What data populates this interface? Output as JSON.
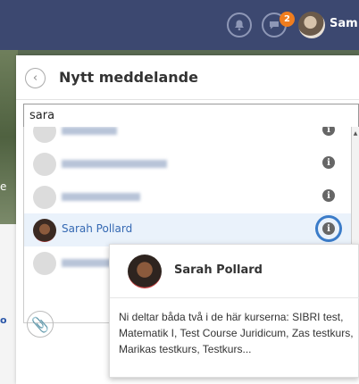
{
  "topbar": {
    "icons": [
      "bell-icon",
      "chat-icon"
    ],
    "badge_count": "2",
    "user_name": "Sam"
  },
  "background": {
    "letter": "e",
    "link_char": "o"
  },
  "dialog": {
    "title": "Nytt meddelande",
    "search_value": "sara"
  },
  "results": [
    {
      "name": "",
      "blurred": true,
      "selected": false
    },
    {
      "name": "",
      "blurred": true,
      "selected": false
    },
    {
      "name": "",
      "blurred": true,
      "selected": false
    },
    {
      "name": "Sarah Pollard",
      "blurred": false,
      "selected": true
    },
    {
      "name": "",
      "blurred": true,
      "selected": false
    }
  ],
  "info_glyph": "i",
  "card": {
    "name": "Sarah Pollard",
    "text": "Ni deltar båda två i de här kurserna: SIBRI test, Matematik I, Test Course Juridicum, Zas testkurs, Marikas testkurs, Testkurs..."
  },
  "colors": {
    "topbar": "#3c4870",
    "badge": "#f07d1e",
    "link": "#3569b3",
    "highlight": "#3b7cc9"
  }
}
